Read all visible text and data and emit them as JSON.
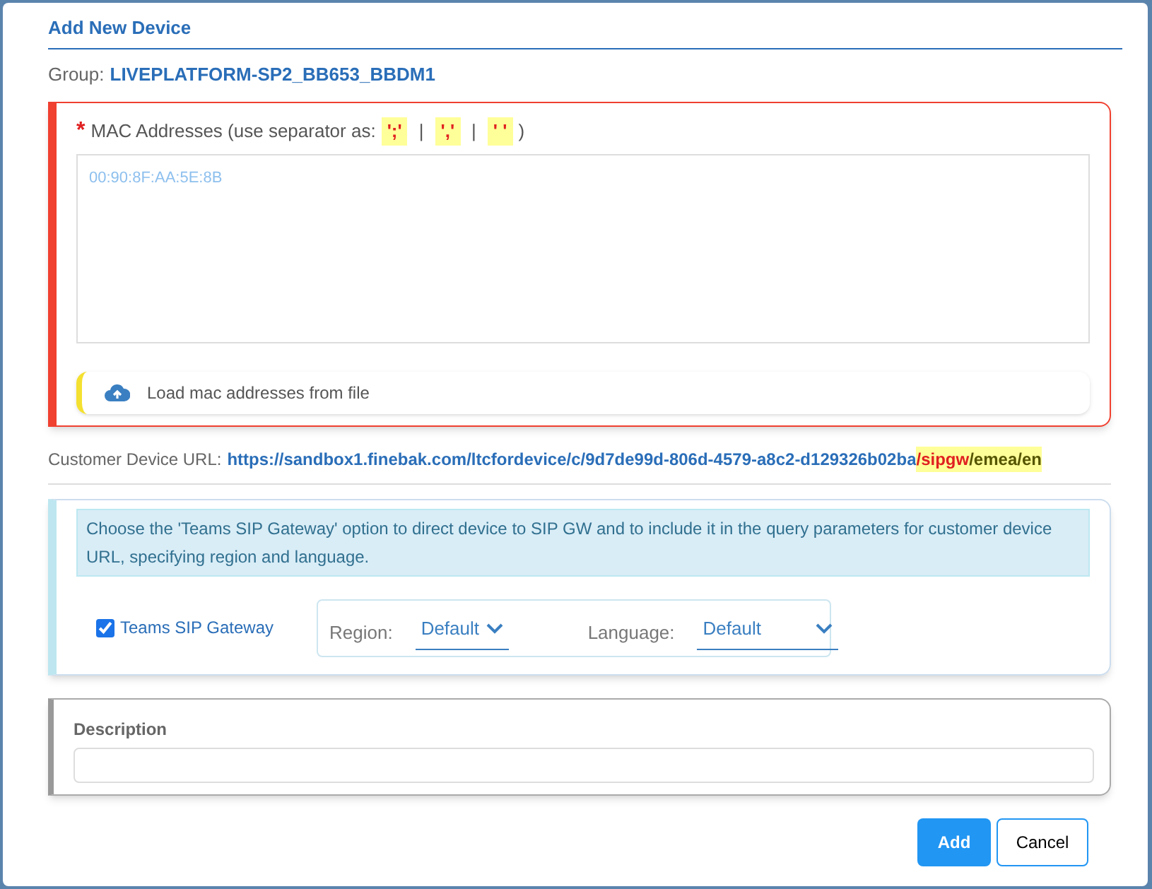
{
  "dialog": {
    "title": "Add New Device"
  },
  "group": {
    "label": "Group:",
    "value": "LIVEPLATFORM-SP2_BB653_BBDM1"
  },
  "mac": {
    "required_mark": "*",
    "label": "MAC Addresses (use separator as:",
    "separators": [
      "';'",
      "','",
      "' '"
    ],
    "divider": "|",
    "close": ")",
    "placeholder": "00:90:8F:AA:5E:8B",
    "load_button": "Load mac addresses from file"
  },
  "customer_url": {
    "label": "Customer Device URL:",
    "segments": [
      {
        "text": "https://sandbox1.finebak.com/ltcfordevice/c/9d7de99d-806d-4579-a8c2-d129326b02ba",
        "kind": "link"
      },
      {
        "text": "/sipgw",
        "kind": "gateway"
      },
      {
        "text": "/emea/en",
        "kind": "params"
      }
    ]
  },
  "sip": {
    "info": "Choose the 'Teams SIP Gateway' option to direct device to SIP GW and to include it in the query parameters for customer device URL, specifying region and language.",
    "checkbox": {
      "label": "Teams SIP Gateway",
      "checked": true
    },
    "region": {
      "label": "Region:",
      "value": "Default"
    },
    "language": {
      "label": "Language:",
      "value": "Default"
    }
  },
  "description": {
    "label": "Description"
  },
  "buttons": [
    {
      "label": "Add",
      "kind": "primary"
    },
    {
      "label": "Cancel",
      "kind": "secondary"
    }
  ]
}
